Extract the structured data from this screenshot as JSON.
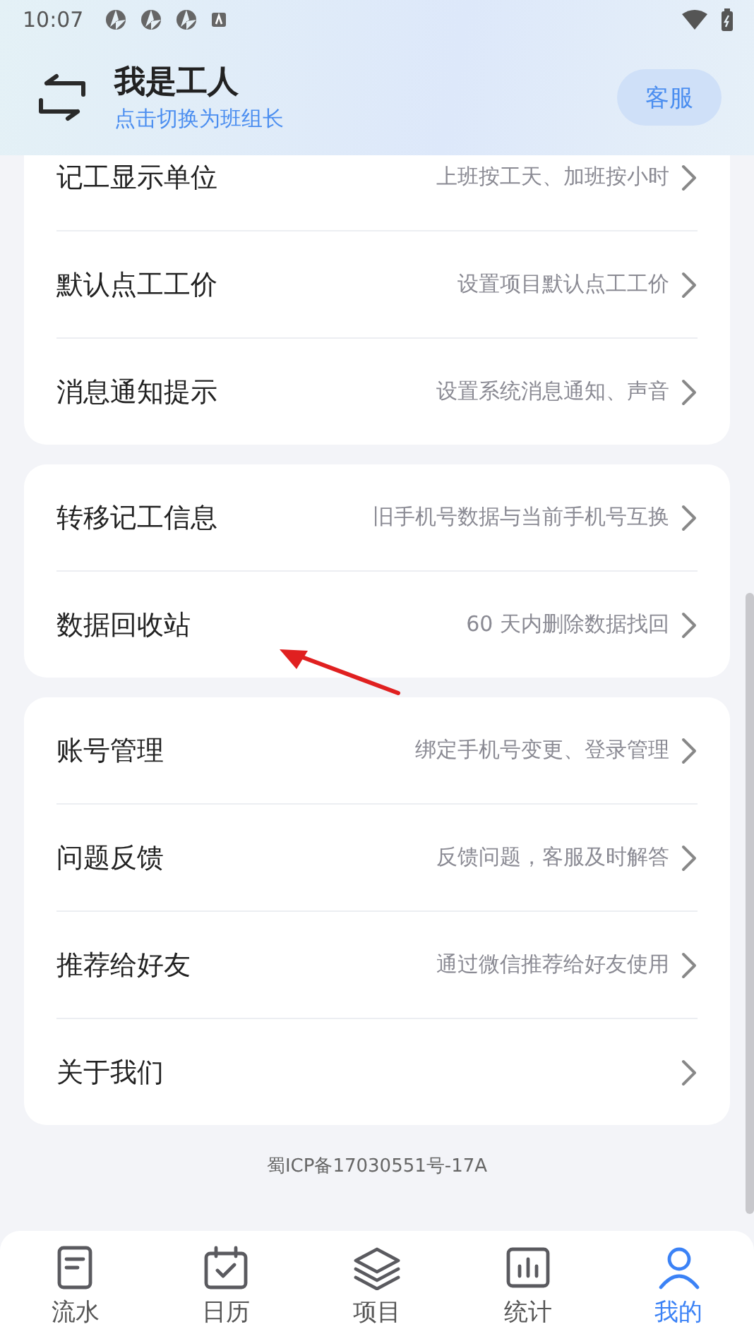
{
  "status_bar": {
    "time": "10:07"
  },
  "header": {
    "title": "我是工人",
    "subtitle": "点击切换为班组长",
    "service_button": "客服"
  },
  "groups": [
    {
      "items": [
        {
          "label": "记工显示单位",
          "detail": "上班按工天、加班按小时"
        },
        {
          "label": "默认点工工价",
          "detail": "设置项目默认点工工价"
        },
        {
          "label": "消息通知提示",
          "detail": "设置系统消息通知、声音"
        }
      ]
    },
    {
      "items": [
        {
          "label": "转移记工信息",
          "detail": "旧手机号数据与当前手机号互换"
        },
        {
          "label": "数据回收站",
          "detail": "60 天内删除数据找回"
        }
      ]
    },
    {
      "items": [
        {
          "label": "账号管理",
          "detail": "绑定手机号变更、登录管理"
        },
        {
          "label": "问题反馈",
          "detail": "反馈问题，客服及时解答"
        },
        {
          "label": "推荐给好友",
          "detail": "通过微信推荐给好友使用"
        },
        {
          "label": "关于我们"
        }
      ]
    }
  ],
  "footer": {
    "icp": "蜀ICP备17030551号-17A"
  },
  "nav": [
    {
      "kind": "list",
      "label": "流水",
      "selected": false
    },
    {
      "kind": "calendar",
      "label": "日历",
      "selected": false
    },
    {
      "kind": "layers",
      "label": "项目",
      "selected": false
    },
    {
      "kind": "chart",
      "label": "统计",
      "selected": false
    },
    {
      "kind": "person",
      "label": "我的",
      "selected": true
    }
  ]
}
